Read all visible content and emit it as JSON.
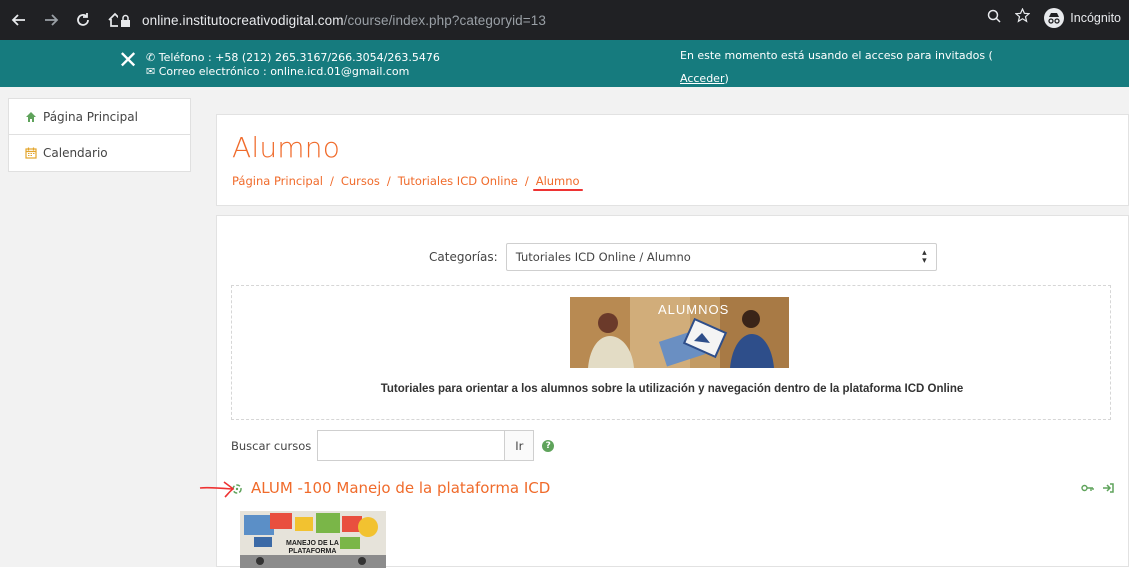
{
  "browser": {
    "url_domain": "online.institutocreativodigital.com",
    "url_path": "/course/index.php?categoryid=13",
    "profile_label": "Incógnito"
  },
  "header": {
    "phone": "Teléfono : +58 (212) 265.3167/266.3054/263.5476",
    "email": "Correo electrónico : online.icd.01@gmail.com",
    "guest_notice": "En este momento está usando el acceso para invitados (",
    "login_link": "Acceder",
    "guest_close": ")"
  },
  "sidebar": {
    "items": [
      {
        "label": "Página Principal",
        "icon": "home-icon"
      },
      {
        "label": "Calendario",
        "icon": "calendar-icon"
      }
    ]
  },
  "page": {
    "title": "Alumno",
    "breadcrumb": [
      "Página Principal",
      "Cursos",
      "Tutoriales ICD Online",
      "Alumno"
    ]
  },
  "category": {
    "label": "Categorías:",
    "selected": "Tutoriales ICD Online / Alumno",
    "banner_text": "ALUMNOS",
    "description": "Tutoriales para orientar a los alumnos sobre la utilización y navegación dentro de la plataforma  ICD Online"
  },
  "search": {
    "label": "Buscar cursos",
    "value": "",
    "button": "Ir"
  },
  "course": {
    "name": "ALUM -100 Manejo de la plataforma ICD",
    "image_text_line1": "MANEJO DE LA",
    "image_text_line2": "PLATAFORMA"
  },
  "colors": {
    "accent": "#f06b2b",
    "header": "#167b7e",
    "chrome": "#202124"
  }
}
